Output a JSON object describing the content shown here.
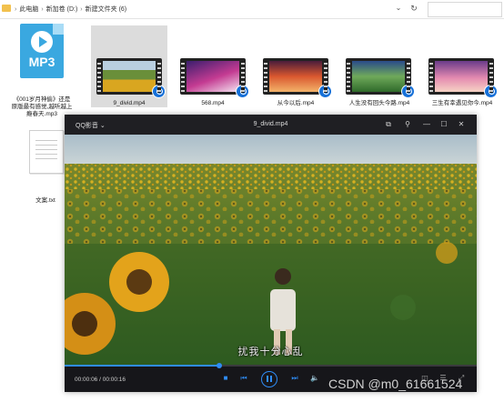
{
  "explorer": {
    "breadcrumbs": [
      "此电脑",
      "新加卷 (D:)",
      "新建文件夹 (6)"
    ]
  },
  "files": [
    {
      "name": "《001岁月神偷》还是原版最有感觉,越听越上瘾春天.mp3",
      "type": "mp3",
      "icon_text": "MP3"
    },
    {
      "name": "9_divid.mp4",
      "type": "video",
      "selected": true
    },
    {
      "name": "568.mp4",
      "type": "video"
    },
    {
      "name": "从今以后.mp4",
      "type": "video"
    },
    {
      "name": "人生没有回头今路.mp4",
      "type": "video"
    },
    {
      "name": "三生有幸遇见你今.mp4",
      "type": "video"
    },
    {
      "name": "文案.txt",
      "type": "txt"
    }
  ],
  "player": {
    "app_name": "QQ影音",
    "file_title": "9_divid.mp4",
    "subtitle": "扰我十分心乱",
    "time": "00:00:06 / 00:00:16",
    "progress": 0.375
  },
  "watermark": "CSDN @m0_61661524",
  "colors": {
    "accent": "#2f8cf5",
    "player_bg": "#1c1c1f",
    "mp3_blue": "#3aa8e0"
  }
}
